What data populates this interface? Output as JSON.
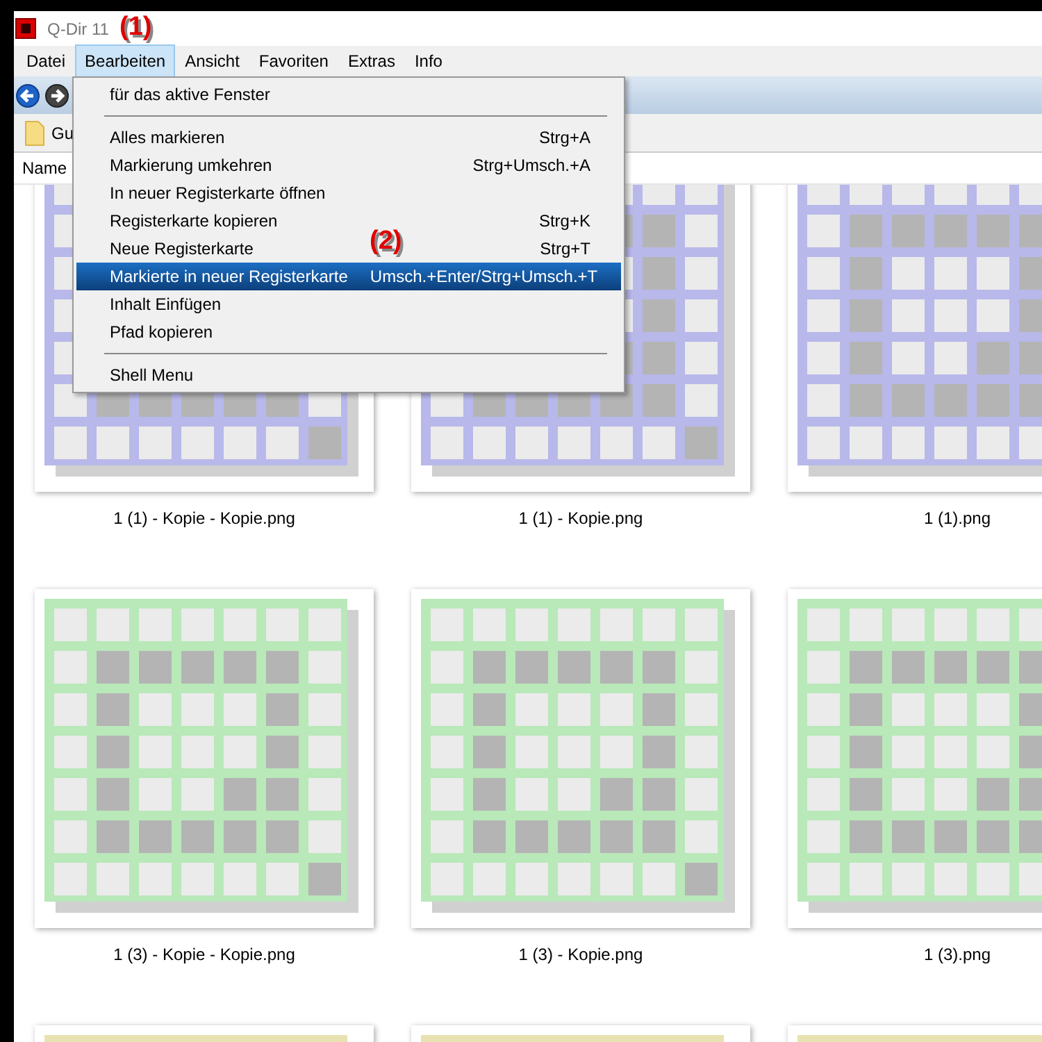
{
  "window": {
    "title": "Q-Dir 11",
    "annotation": "(1)"
  },
  "menu_bar": [
    {
      "label": "Datei",
      "selected": false
    },
    {
      "label": "Bearbeiten",
      "selected": true
    },
    {
      "label": "Ansicht",
      "selected": false
    },
    {
      "label": "Favoriten",
      "selected": false
    },
    {
      "label": "Extras",
      "selected": false
    },
    {
      "label": "Info",
      "selected": false
    }
  ],
  "tab": {
    "label": "Gu"
  },
  "column_header": {
    "label": "Name"
  },
  "dropdown": {
    "annotation": "(2)",
    "items": [
      {
        "kind": "item",
        "label": "für das aktive Fenster",
        "selected": false
      },
      {
        "kind": "separator"
      },
      {
        "kind": "item",
        "label": "Alles markieren",
        "shortcut": "Strg+A",
        "selected": false
      },
      {
        "kind": "item",
        "label": "Markierung umkehren",
        "shortcut": "Strg+Umsch.+A",
        "selected": false
      },
      {
        "kind": "item",
        "label": "In neuer Registerkarte öffnen",
        "selected": false
      },
      {
        "kind": "item",
        "label": "Registerkarte kopieren",
        "shortcut": "Strg+K",
        "selected": false
      },
      {
        "kind": "item",
        "label": "Neue Registerkarte",
        "shortcut": "Strg+T",
        "selected": false
      },
      {
        "kind": "item",
        "label": "Markierte in neuer Registerkarte",
        "shortcut": "Umsch.+Enter/Strg+Umsch.+T",
        "selected": true
      },
      {
        "kind": "item",
        "label": "Inhalt Einfügen",
        "selected": false
      },
      {
        "kind": "item",
        "label": "Pfad kopieren",
        "selected": false
      },
      {
        "kind": "separator"
      },
      {
        "kind": "item",
        "label": "Shell Menu",
        "selected": false
      }
    ]
  },
  "files": [
    {
      "label": "1 (1) - Kopie - Kopie.png",
      "color": "#b8b8ea"
    },
    {
      "label": "1 (1) - Kopie.png",
      "color": "#b8b8ea"
    },
    {
      "label": "1 (1).png",
      "color": "#b8b8ea"
    },
    {
      "label": "1 (3) - Kopie - Kopie.png",
      "color": "#b9e8b9"
    },
    {
      "label": "1 (3) - Kopie.png",
      "color": "#b9e8b9"
    },
    {
      "label": "1 (3).png",
      "color": "#b9e8b9"
    },
    {
      "color": "#e8e2b2"
    },
    {
      "color": "#e8e2b2"
    },
    {
      "color": "#e8e2b2"
    }
  ]
}
